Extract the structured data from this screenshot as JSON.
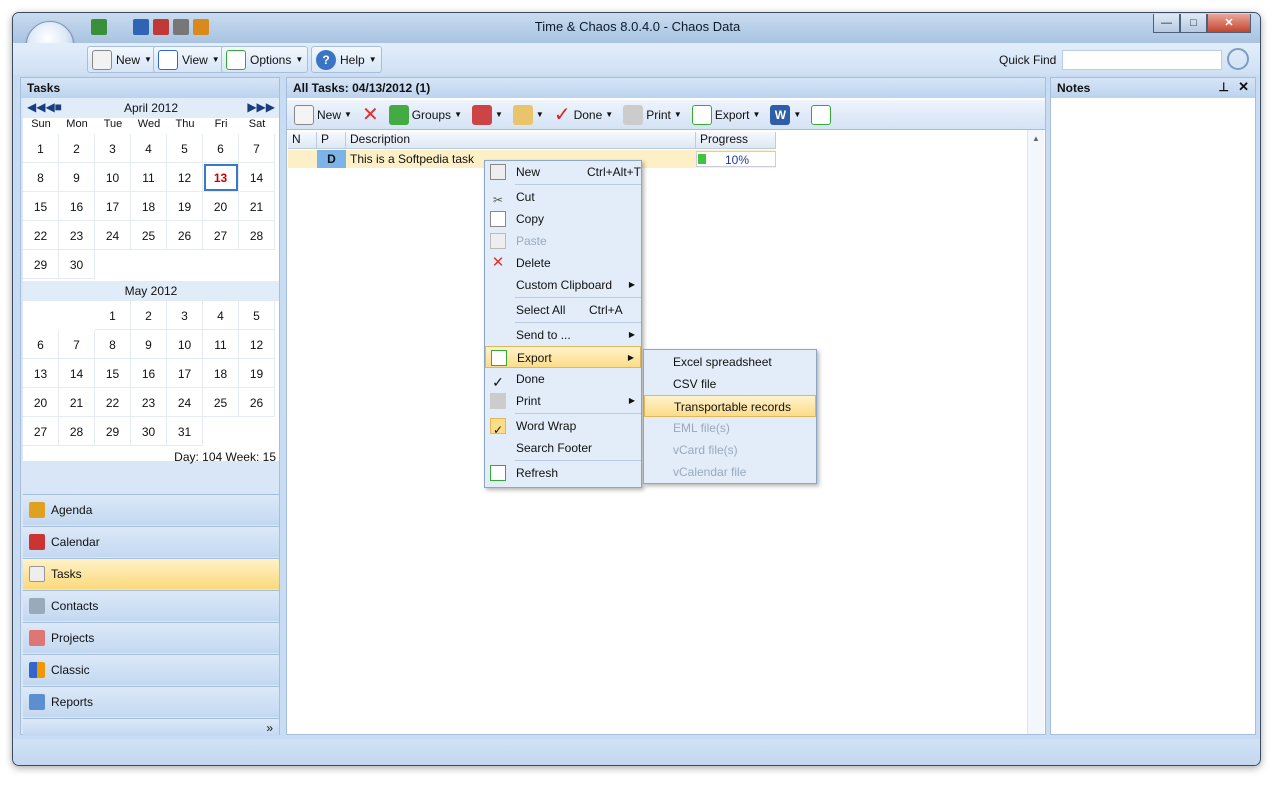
{
  "window": {
    "title": "Time & Chaos 8.0.4.0 - Chaos Data"
  },
  "menubar": {
    "new": "New",
    "view": "View",
    "options": "Options",
    "help": "Help",
    "quick_find_label": "Quick Find",
    "quick_find_value": ""
  },
  "tasks_pane": {
    "title": "Tasks"
  },
  "calendar": {
    "april": {
      "title": "April 2012",
      "weeks": [
        [
          "",
          "1",
          "2",
          "3",
          "4",
          "5",
          "6",
          "7"
        ],
        [
          "8",
          "9",
          "10",
          "11",
          "12",
          "13",
          "14"
        ],
        [
          "15",
          "16",
          "17",
          "18",
          "19",
          "20",
          "21"
        ],
        [
          "22",
          "23",
          "24",
          "25",
          "26",
          "27",
          "28"
        ],
        [
          "29",
          "30",
          "",
          "",
          "",
          "",
          ""
        ]
      ]
    },
    "may": {
      "title": "May 2012"
    },
    "dow": [
      "Sun",
      "Mon",
      "Tue",
      "Wed",
      "Thu",
      "Fri",
      "Sat"
    ],
    "footer": "Day: 104  Week: 15"
  },
  "nav": [
    "Agenda",
    "Calendar",
    "Tasks",
    "Contacts",
    "Projects",
    "Classic",
    "Reports"
  ],
  "main": {
    "header": "All Tasks: 04/13/2012  (1)"
  },
  "toolbar": {
    "new": "New",
    "groups": "Groups",
    "done": "Done",
    "print": "Print",
    "export": "Export"
  },
  "grid": {
    "columns": [
      "N",
      "P",
      "Description",
      "Progress"
    ],
    "row": {
      "priority": "D",
      "description": "This is a Softpedia task",
      "progress": "10%",
      "progress_value": 0.1
    }
  },
  "notes": {
    "title": "Notes"
  },
  "context_menu": {
    "new": "New",
    "new_shortcut": "Ctrl+Alt+T",
    "cut": "Cut",
    "copy": "Copy",
    "paste": "Paste",
    "delete": "Delete",
    "custom_clipboard": "Custom Clipboard",
    "select_all": "Select All",
    "select_all_shortcut": "Ctrl+A",
    "send_to": "Send to ...",
    "export": "Export",
    "done": "Done",
    "print": "Print",
    "word_wrap": "Word Wrap",
    "search_footer": "Search Footer",
    "refresh": "Refresh"
  },
  "export_menu": {
    "excel": "Excel spreadsheet",
    "csv": "CSV file",
    "transportable": "Transportable records",
    "eml": "EML file(s)",
    "vcard": "vCard file(s)",
    "vcalendar": "vCalendar file"
  },
  "colors": {
    "accent": "#c8dcf3",
    "highlight": "#fbdd88",
    "today": "#cc0000"
  }
}
